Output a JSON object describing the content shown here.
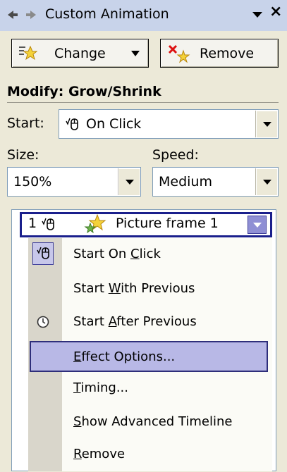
{
  "titlebar": {
    "title": "Custom Animation",
    "menu_icon": "triangle-down",
    "close_label": "×"
  },
  "toolbar": {
    "change_label": "Change",
    "remove_label": "Remove"
  },
  "modify": {
    "heading": "Modify: Grow/Shrink",
    "start_label": "Start:",
    "start_value": "On Click",
    "size_label": "Size:",
    "size_value": "150%",
    "speed_label": "Speed:",
    "speed_value": "Medium"
  },
  "list": {
    "selected_item": {
      "number": "1",
      "label": "Picture frame 1"
    }
  },
  "context_menu": {
    "items": [
      {
        "label": "Start On Click",
        "underline": "C",
        "checked": true
      },
      {
        "label": "Start With Previous",
        "underline": "W"
      },
      {
        "label": "Start After Previous",
        "underline": "A",
        "icon": "clock"
      },
      {
        "label": "Effect Options...",
        "underline": "E",
        "highlighted": true
      },
      {
        "label": "Timing...",
        "underline": "T"
      },
      {
        "label": "Show Advanced Timeline",
        "underline": "S"
      },
      {
        "label": "Remove",
        "underline": "R"
      }
    ]
  },
  "colors": {
    "titlebar_bg": "#c8d3ea",
    "panel_bg": "#ece9d8",
    "selection_border": "#1a1f8c",
    "menu_highlight": "#b8b8e6"
  }
}
